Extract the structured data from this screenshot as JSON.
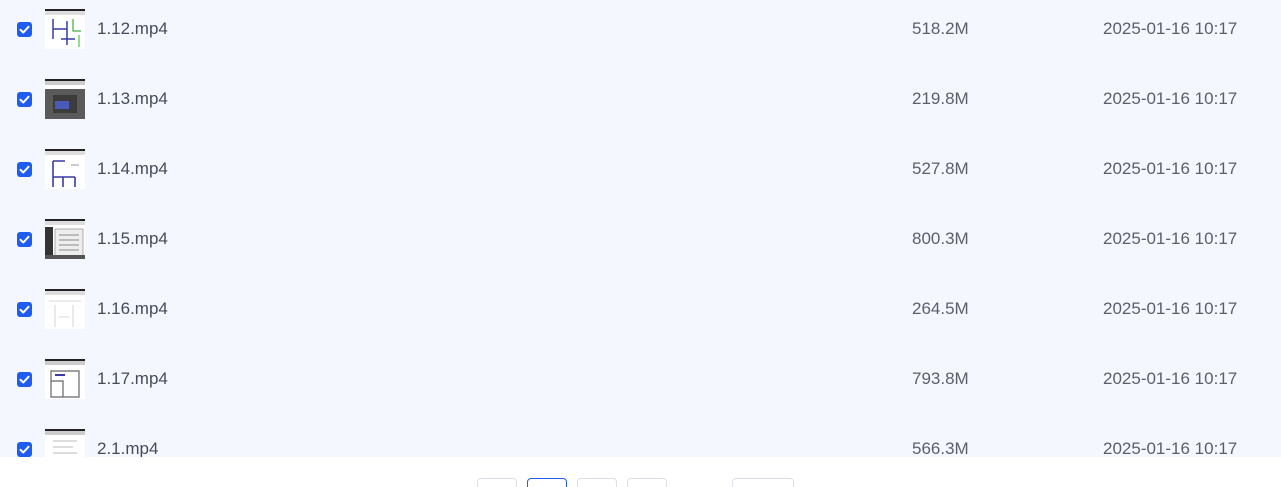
{
  "files": [
    {
      "name": "1.12.mp4",
      "size": "518.2M",
      "modified": "2025-01-16 10:17",
      "checked": true,
      "thumbnail": "floorplan-blue-green"
    },
    {
      "name": "1.13.mp4",
      "size": "219.8M",
      "modified": "2025-01-16 10:17",
      "checked": true,
      "thumbnail": "3d-render-dark"
    },
    {
      "name": "1.14.mp4",
      "size": "527.8M",
      "modified": "2025-01-16 10:17",
      "checked": true,
      "thumbnail": "floorplan-blue"
    },
    {
      "name": "1.15.mp4",
      "size": "800.3M",
      "modified": "2025-01-16 10:17",
      "checked": true,
      "thumbnail": "settings-dialog"
    },
    {
      "name": "1.16.mp4",
      "size": "264.5M",
      "modified": "2025-01-16 10:17",
      "checked": true,
      "thumbnail": "blank-drawing"
    },
    {
      "name": "1.17.mp4",
      "size": "793.8M",
      "modified": "2025-01-16 10:17",
      "checked": true,
      "thumbnail": "floorplan-outline"
    },
    {
      "name": "2.1.mp4",
      "size": "566.3M",
      "modified": "2025-01-16 10:17",
      "checked": true,
      "thumbnail": "document-page"
    }
  ],
  "pagination": {
    "controls": [
      "prev",
      "page",
      "page",
      "page",
      "jump"
    ],
    "active_index": 1
  },
  "colors": {
    "accent": "#1f5cf0",
    "list_background": "#f5f7ff",
    "text": "#454b57"
  }
}
